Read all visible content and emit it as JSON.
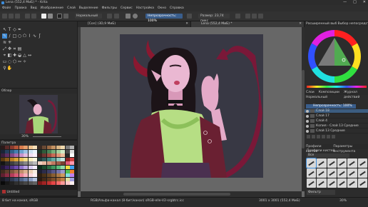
{
  "window": {
    "title": "Lena (552,4 МиБ) * - Krita",
    "controls": [
      "—",
      "□",
      "✕"
    ]
  },
  "menubar": {
    "items": [
      "Файл",
      "Правка",
      "Вид",
      "Изображение",
      "Слой",
      "Выделение",
      "Фильтры",
      "Сервис",
      "Настройка",
      "Окно",
      "Справка"
    ]
  },
  "toolbar": {
    "blend_mode": "Нормальный",
    "opacity_label": "Непрозрачность: 100%",
    "size_label": "Размер: 23,74 пикс"
  },
  "tabs": [
    {
      "label": "[Con] (3D,9 МиБ)",
      "active": false
    },
    {
      "label": "Lena (552,4 МиБ) *",
      "active": true
    }
  ],
  "overview": {
    "title": "Обзор",
    "zoom": "30%"
  },
  "palette": {
    "title": "Палитра",
    "footer_label": "Untitled",
    "colors": [
      "#2b1a1a",
      "#5a2a28",
      "#8a3a2e",
      "#b5573a",
      "#d97d4e",
      "#e7a06b",
      "#f1c48f",
      "#f7dfb8",
      "#3a2a22",
      "#6a4a34",
      "#9a6a44",
      "#c39262",
      "#dcb886",
      "#eed8ae",
      "#7a7a7a",
      "#b0b0b0",
      "#1a2436",
      "#25405e",
      "#325e88",
      "#457fb0",
      "#6ea2cf",
      "#9ec2e4",
      "#cfe2f2",
      "#ecf4fb",
      "#1e3526",
      "#2f5a3a",
      "#4a8456",
      "#74ad78",
      "#a3cf9c",
      "#d0eac6",
      "#4a4a4a",
      "#dcdcdc",
      "#3c1e3e",
      "#5e2e62",
      "#844a88",
      "#a86aac",
      "#c993cb",
      "#e2bde2",
      "#f3def2",
      "#fbf0fa",
      "#402220",
      "#6e3430",
      "#a04a40",
      "#c86a56",
      "#e09476",
      "#eebc9c",
      "#262626",
      "#ffffff",
      "#5a3a10",
      "#8a5a1a",
      "#b97e24",
      "#daa238",
      "#edc45a",
      "#f5de8c",
      "#faf0c0",
      "#fdf8e0",
      "#203a3a",
      "#2e5a58",
      "#3e8480",
      "#62aaa2",
      "#90cac2",
      "#c4e6e0",
      "#8a2020",
      "#d04040",
      "#141414",
      "#2a2a2a",
      "#404040",
      "#565656",
      "#6e6e6e",
      "#888888",
      "#a2a2a2",
      "#bcbcbc",
      "#f0d0c0",
      "#e8b8a0",
      "#d89a80",
      "#c07a62",
      "#a05c48",
      "#7a4032",
      "#e05a7a",
      "#ff9ab0",
      "#24143a",
      "#3a2260",
      "#523488",
      "#6e4cae",
      "#9274cc",
      "#b8a2e2",
      "#dccef2",
      "#f2ecfa",
      "#0e2a1a",
      "#1a4a2e",
      "#2a6e44",
      "#3e965e",
      "#5cbe7e",
      "#90dca8",
      "#f0e040",
      "#40a0f0",
      "#402a1e",
      "#5e3e2c",
      "#7e543c",
      "#a06e50",
      "#c08e6c",
      "#dcb090",
      "#eed0b6",
      "#f8ece0",
      "#1e1e30",
      "#2c2c4a",
      "#3e3e66",
      "#565688",
      "#7474aa",
      "#9a9acc",
      "#50c050",
      "#f08030",
      "#602030",
      "#8a2c44",
      "#b43c5a",
      "#d65a76",
      "#ec8498",
      "#f6b0bc",
      "#fbd6dc",
      "#fdeef0",
      "#302010",
      "#4a3218",
      "#664624",
      "#885e32",
      "#aa7a46",
      "#cc9a60",
      "#80e0e0",
      "#c080f0",
      "#1a1a24",
      "#24283a",
      "#303a52",
      "#3e4e6c",
      "#506488",
      "#687ea6",
      "#8a9cc2",
      "#b2c0de",
      "#2a1a10",
      "#442a18",
      "#5e3a20",
      "#7c4e2a",
      "#9c6436",
      "#be7e46",
      "#e0e0a0",
      "#a0a0e0",
      "#0a0a0a",
      "#181818",
      "#222222",
      "#303030",
      "#3a3a3a",
      "#464646",
      "#545454",
      "#626262",
      "#7e1818",
      "#a02424",
      "#c23232",
      "#e44646",
      "#f66a6a",
      "#fa9a9a",
      "#fdcaca",
      "#fff0f0"
    ]
  },
  "right_panel": {
    "color_tabs": [
      "Расширенный выбор цвета",
      "Выбор непосредственный"
    ],
    "mid_tabs": [
      "Слои",
      "Композиции",
      "Журнал действий"
    ],
    "layer_blend": "Нормальный",
    "layer_opacity": "Непрозрачность: 100%",
    "layers": [
      {
        "name": "Слой 18",
        "selected": true
      },
      {
        "name": "Слой 17",
        "selected": false
      },
      {
        "name": "Слой 4",
        "selected": false
      },
      {
        "name": "Копия - Слой 13 Средние",
        "selected": false
      },
      {
        "name": "Слой 13 Средние",
        "selected": false
      }
    ],
    "brush_tabs": [
      "Профили кистей",
      "Параметры инструмента"
    ],
    "brush_presets_title": "Профили кистей",
    "brush_tag": "Все",
    "brush_filter": "Фильтр"
  },
  "statusbar": {
    "left": "8 бит на канал, sRGB",
    "mid": "RGB/Альфа-канал (8-бит/канал) sRGB-elle-V2-srgbtrc.icc",
    "size": "3001 x 3001 (552,4 МиБ)",
    "zoom": "30%"
  },
  "colors": {
    "accent": "#3d8cd9",
    "canvas_bg": "#676767",
    "panel_bg": "#2c2c2c"
  }
}
